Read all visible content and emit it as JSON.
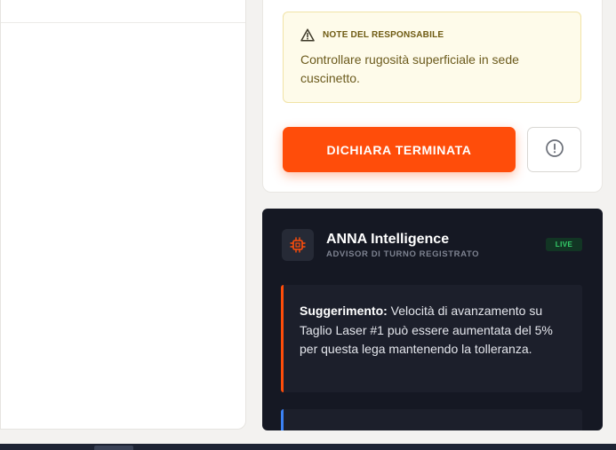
{
  "note": {
    "title": "NOTE DEL RESPONSABILE",
    "text": "Controllare rugosità superficiale in sede cuscinetto.",
    "icon": "warning-icon"
  },
  "actions": {
    "done_label": "DICHIARA TERMINATA",
    "alert_icon": "alert-circle-icon",
    "accent": "#ff4d0a"
  },
  "assistant": {
    "icon": "cpu-chip-icon",
    "title": "ANNA Intelligence",
    "subtitle": "ADVISOR DI TURNO REGISTRATO",
    "live_badge": "LIVE",
    "suggestion": {
      "label": "Suggerimento:",
      "text": "Velocità di avanzamento su Taglio Laser #1 può essere aumentata del 5% per questa lega mantenendo la tolleranza."
    }
  }
}
